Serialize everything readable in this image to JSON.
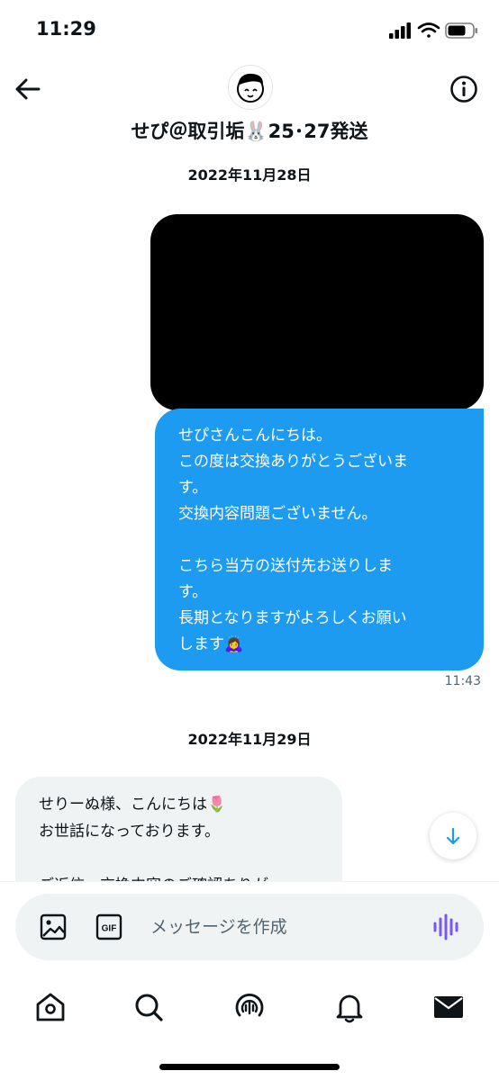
{
  "status_bar": {
    "time": "11:29"
  },
  "header": {
    "back_label": "戻る",
    "name": "せぴ＠取引垢🐰25･27発送",
    "info_label": "情報"
  },
  "conversation": {
    "date_1": "2022年11月28日",
    "sent_message": {
      "lines": [
        "せぴさんこんにちは。",
        "この度は交換ありがとうございま",
        "す。",
        "交換内容問題ございません。",
        "",
        "こちら当方の送付先お送りしま",
        "す。",
        "長期となりますがよろしくお願い",
        "します🙇‍♀️"
      ],
      "time": "11:43"
    },
    "date_2": "2022年11月29日",
    "received_message": {
      "lines": [
        "せりーぬ様、こんにちは🌷",
        "お世話になっております。",
        "",
        "ご返信、交換内容のご確認ありが"
      ]
    }
  },
  "composer": {
    "placeholder": "メッセージを作成",
    "gif_label": "GIF"
  },
  "colors": {
    "accent": "#1d9bf0",
    "received_bubble": "#eff3f4",
    "voice": "#7856ff"
  },
  "icons": [
    "back-arrow-icon",
    "info-icon",
    "image-icon",
    "gif-icon",
    "voice-icon",
    "home-icon",
    "search-icon",
    "spaces-icon",
    "bell-icon",
    "mail-icon",
    "chevron-down-icon"
  ]
}
